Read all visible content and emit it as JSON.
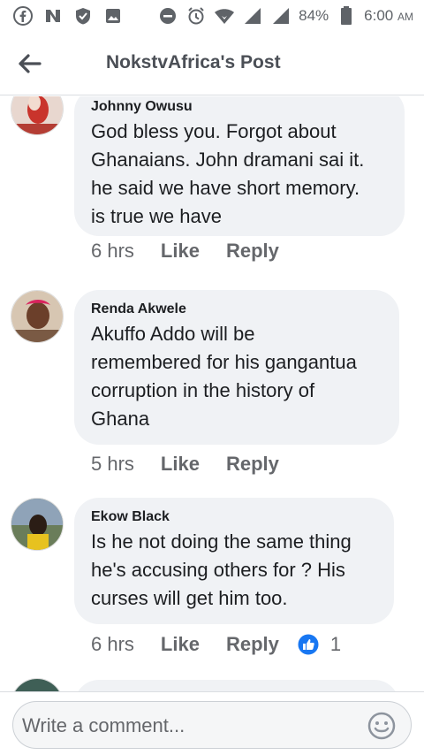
{
  "status_bar": {
    "battery": "84%",
    "time": "6:00",
    "ampm": "AM"
  },
  "header": {
    "title": "NokstvAfrica's Post"
  },
  "comments": [
    {
      "author": "Johnny Owusu",
      "text_lines": [
        "God bless you. Forgot about",
        "Ghanaians. John dramani sai it.",
        "he said we have short memory.",
        "is true we have"
      ],
      "time": "6 hrs",
      "like": "Like",
      "reply": "Reply"
    },
    {
      "author": "Renda Akwele",
      "text_lines": [
        "Akuffo Addo will be",
        "remembered for his gangantua",
        "corruption in the history of",
        "Ghana"
      ],
      "time": "5 hrs",
      "like": "Like",
      "reply": "Reply"
    },
    {
      "author": "Ekow Black",
      "text_lines": [
        "Is he not doing the same thing",
        "he's accusing others for ? His",
        "curses will get him too."
      ],
      "time": "6 hrs",
      "like": "Like",
      "reply": "Reply",
      "reaction_count": "1"
    }
  ],
  "composer": {
    "placeholder": "Write a comment..."
  },
  "colors": {
    "bubble": "#f0f2f5",
    "like_blue": "#1877f2",
    "meta_gray": "#65676b"
  }
}
